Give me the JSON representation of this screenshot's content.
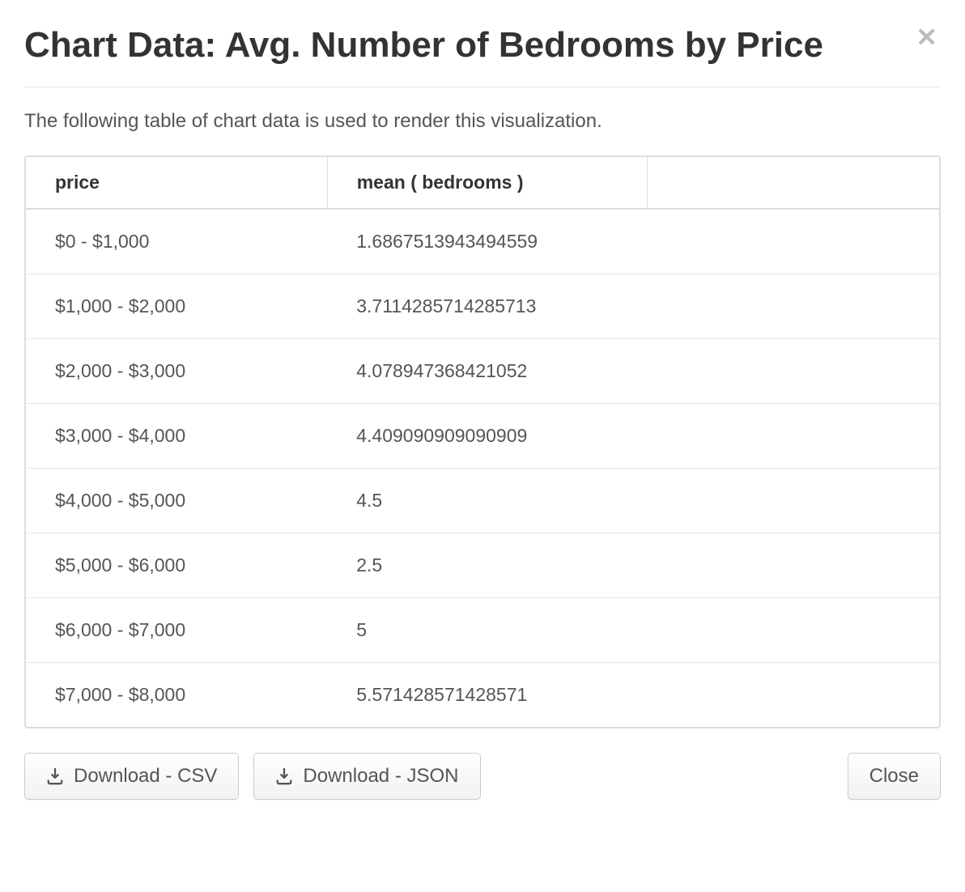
{
  "modal": {
    "title": "Chart Data: Avg. Number of Bedrooms by Price",
    "description": "The following table of chart data is used to render this visualization."
  },
  "table": {
    "headers": {
      "price": "price",
      "mean": "mean ( bedrooms )"
    },
    "rows": [
      {
        "price": "$0 - $1,000",
        "mean": "1.6867513943494559"
      },
      {
        "price": "$1,000 - $2,000",
        "mean": "3.7114285714285713"
      },
      {
        "price": "$2,000 - $3,000",
        "mean": "4.078947368421052"
      },
      {
        "price": "$3,000 - $4,000",
        "mean": "4.409090909090909"
      },
      {
        "price": "$4,000 - $5,000",
        "mean": "4.5"
      },
      {
        "price": "$5,000 - $6,000",
        "mean": "2.5"
      },
      {
        "price": "$6,000 - $7,000",
        "mean": "5"
      },
      {
        "price": "$7,000 - $8,000",
        "mean": "5.571428571428571"
      }
    ]
  },
  "buttons": {
    "download_csv": "Download - CSV",
    "download_json": "Download - JSON",
    "close": "Close"
  },
  "chart_data": {
    "type": "table",
    "title": "Avg. Number of Bedrooms by Price",
    "columns": [
      "price",
      "mean ( bedrooms )"
    ],
    "x": [
      "$0 - $1,000",
      "$1,000 - $2,000",
      "$2,000 - $3,000",
      "$3,000 - $4,000",
      "$4,000 - $5,000",
      "$5,000 - $6,000",
      "$6,000 - $7,000",
      "$7,000 - $8,000"
    ],
    "values": [
      1.6867513943494559,
      3.7114285714285713,
      4.078947368421052,
      4.409090909090909,
      4.5,
      2.5,
      5,
      5.571428571428571
    ]
  }
}
